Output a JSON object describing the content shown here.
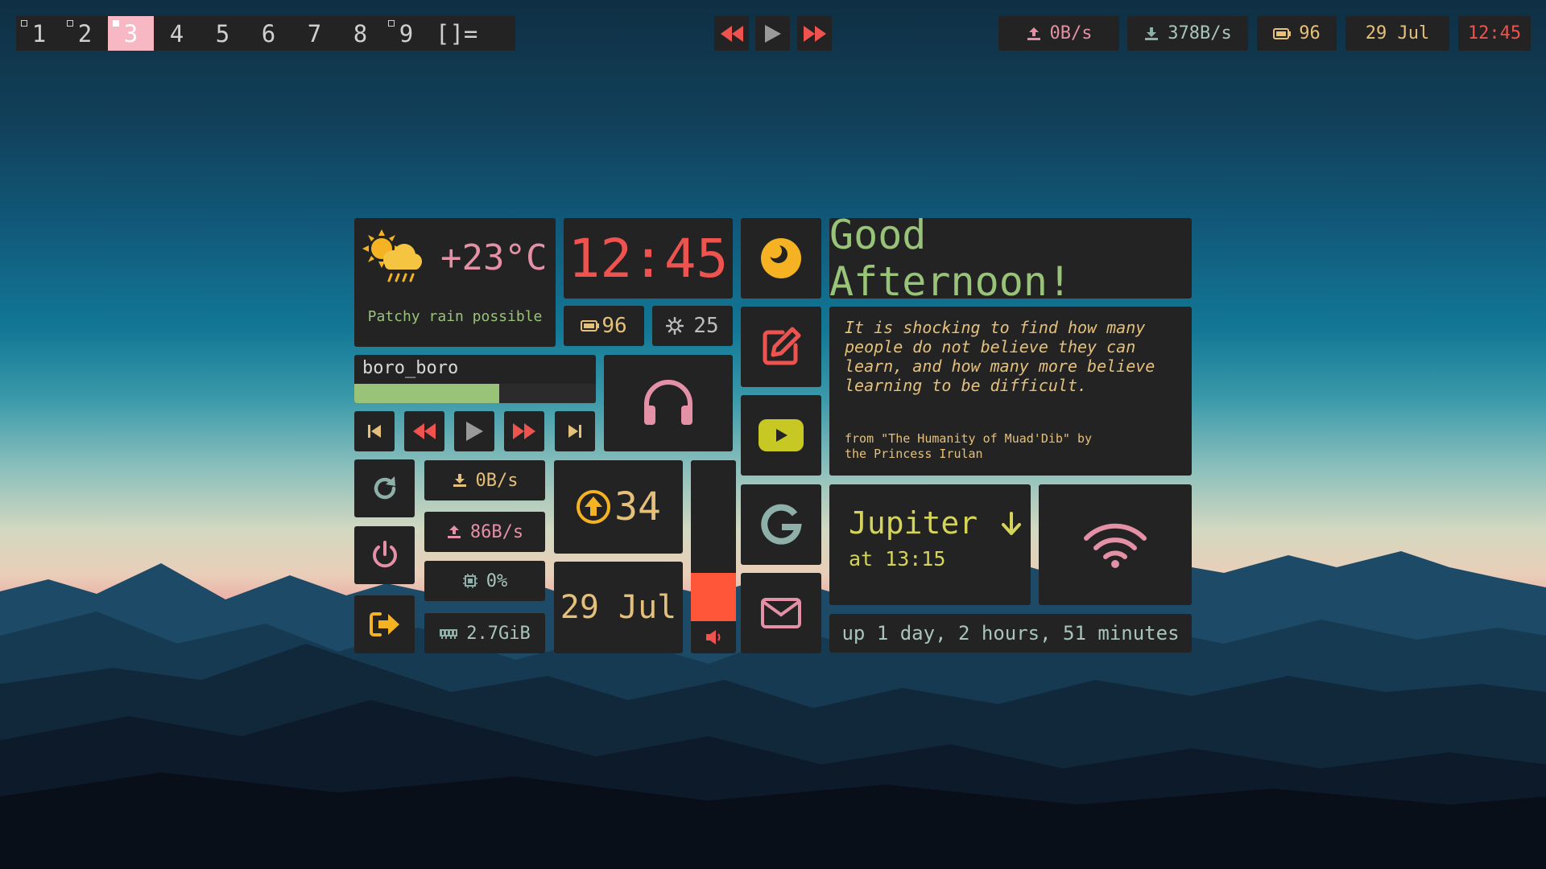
{
  "colors": {
    "accent_pink": "#f7b7c3",
    "red": "#ef5350",
    "yellow": "#e5c07b",
    "green": "#98c379",
    "pink": "#e490a6",
    "panel": "#232323"
  },
  "topbar": {
    "workspaces": [
      "1",
      "2",
      "3",
      "4",
      "5",
      "6",
      "7",
      "8",
      "9"
    ],
    "active_workspace": "3",
    "layout": "[]=",
    "upload": "0B/s",
    "download": "378B/s",
    "battery": "96",
    "date": "29 Jul",
    "time": "12:45"
  },
  "weather": {
    "temperature": "+23°C",
    "description": "Patchy rain possible",
    "icon": "partly-cloudy-rain-icon"
  },
  "clock": {
    "time": "12:45"
  },
  "battery_widget": {
    "value": "96"
  },
  "brightness_widget": {
    "value": "25"
  },
  "music": {
    "title": "boro_boro",
    "progress": 0.6
  },
  "greeting": "Good Afternoon!",
  "quote": {
    "text": "It is shocking to find how many people do not believe they can learn, and how many more believe learning to be difficult.",
    "source": "from \"The Humanity of Muad'Dib\" by the Princess Irulan"
  },
  "stats": {
    "download": "0B/s",
    "upload": "86B/s",
    "cpu": "0%",
    "ram": "2.7GiB"
  },
  "updates": {
    "count": "34"
  },
  "date_widget": "29 Jul",
  "volume": {
    "level": 0.3
  },
  "sun": {
    "planet": "Jupiter",
    "time": "at 13:15"
  },
  "uptime": "up 1 day, 2 hours, 51 minutes"
}
